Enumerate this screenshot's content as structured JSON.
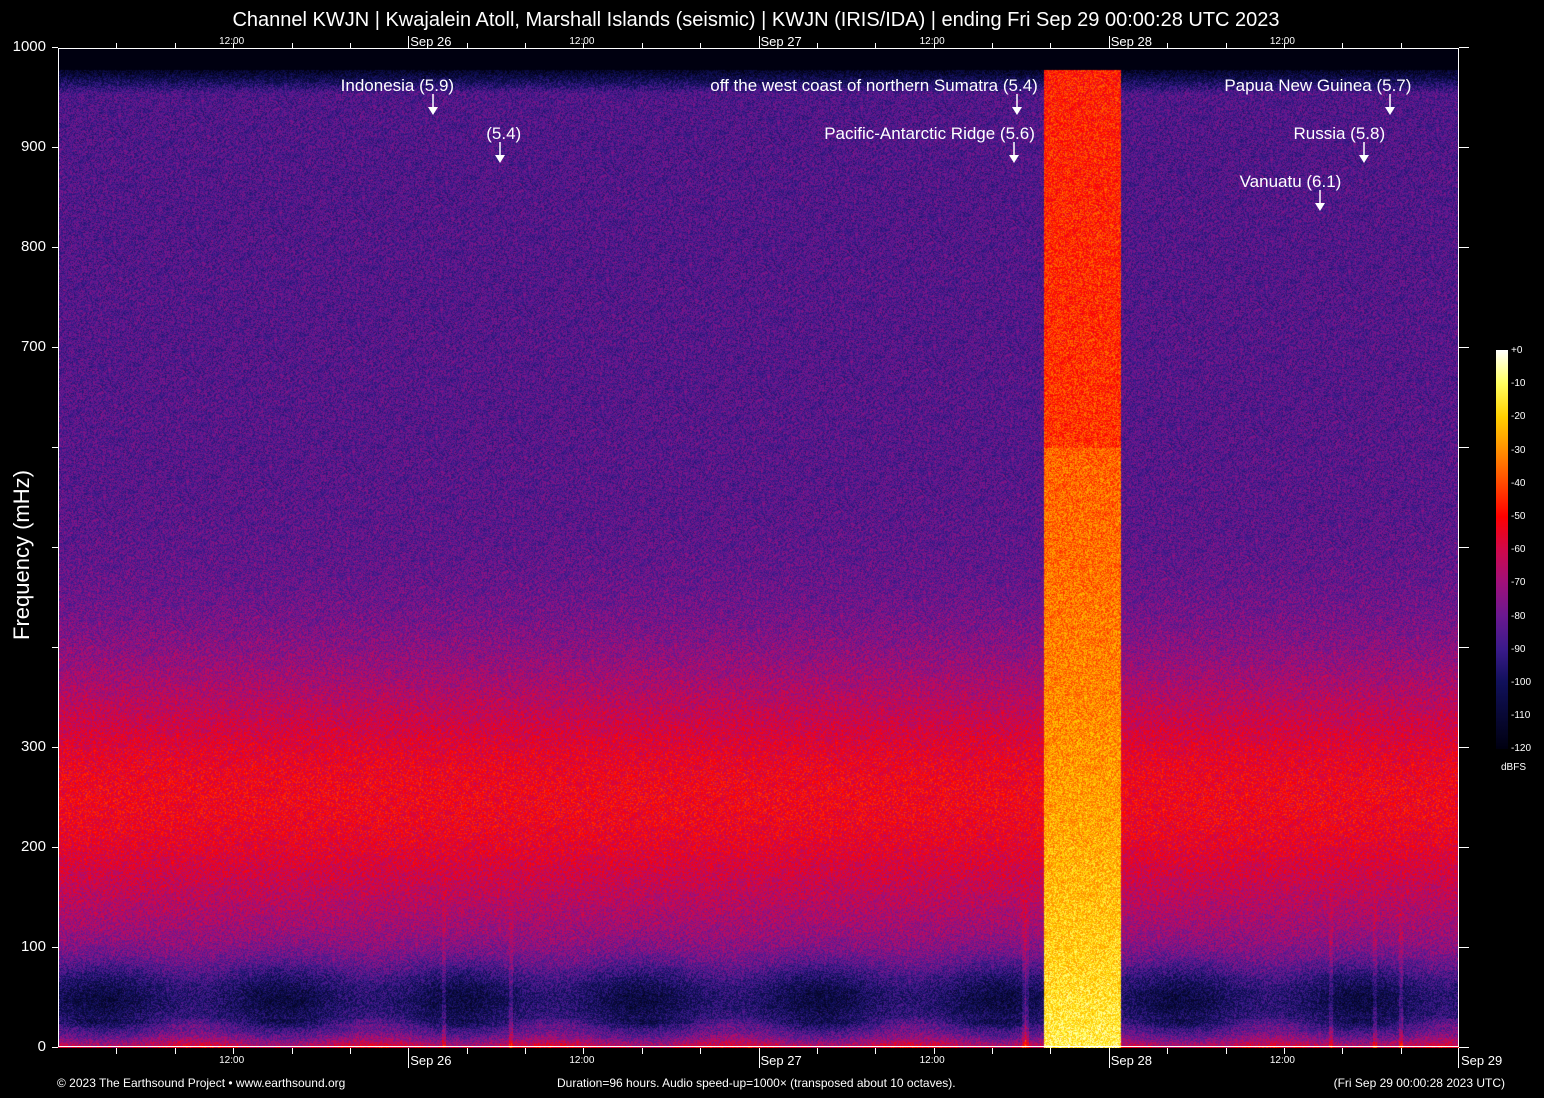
{
  "chart_data": {
    "type": "heatmap",
    "title": "Channel KWJN | Kwajalein Atoll, Marshall Islands (seismic) | KWJN (IRIS/IDA) | ending Fri Sep 29 00:00:28 UTC 2023",
    "ylabel": "Frequency (mHz)",
    "ylim": [
      0,
      1000
    ],
    "yticks": [
      {
        "value": 0,
        "label": "0"
      },
      {
        "value": 100,
        "label": "100"
      },
      {
        "value": 200,
        "label": "200"
      },
      {
        "value": 300,
        "label": "300"
      },
      {
        "value": 400,
        "label": ""
      },
      {
        "value": 500,
        "label": ""
      },
      {
        "value": 600,
        "label": ""
      },
      {
        "value": 700,
        "label": "700"
      },
      {
        "value": 800,
        "label": "800"
      },
      {
        "value": 900,
        "label": "900"
      },
      {
        "value": 1000,
        "label": "1000"
      }
    ],
    "xlim_hours": [
      0,
      96
    ],
    "xticks_major": [
      {
        "hour": 24,
        "label": "Sep 26"
      },
      {
        "hour": 48,
        "label": "Sep 27"
      },
      {
        "hour": 72,
        "label": "Sep 28"
      },
      {
        "hour": 96,
        "label": "Sep 29"
      }
    ],
    "xticks_minor_labeled": [
      {
        "hour": 12,
        "label": "12:00"
      },
      {
        "hour": 36,
        "label": "12:00"
      },
      {
        "hour": 60,
        "label": "12:00"
      },
      {
        "hour": 84,
        "label": "12:00"
      }
    ],
    "minor_tick_interval_hours": 4,
    "colorbar": {
      "unit": "dBFS",
      "range": [
        -120,
        0
      ],
      "ticks": [
        "+0",
        "-10",
        "-20",
        "-30",
        "-40",
        "-50",
        "-60",
        "-70",
        "-80",
        "-90",
        "-100",
        "-110",
        "-120"
      ],
      "colors": [
        "#000010",
        "#10105a",
        "#3a1a8a",
        "#6a1890",
        "#a0107a",
        "#d0084a",
        "#ff0000",
        "#ff4a00",
        "#ff9000",
        "#ffd000",
        "#ffff60",
        "#ffffff"
      ]
    },
    "events": [
      {
        "label": "Indonesia (5.9)",
        "hour": 25.7
      },
      {
        "label": "(5.4)",
        "hour": 30.3
      },
      {
        "label": "off the west coast of northern Sumatra (5.4)",
        "hour": 65.7
      },
      {
        "label": "Pacific-Antarctic Ridge (5.6)",
        "hour": 65.5
      },
      {
        "label": "Vanuatu (6.1)",
        "hour": 86.5
      },
      {
        "label": "Russia (5.8)",
        "hour": 89.5
      },
      {
        "label": "Papua New Guinea (5.7)",
        "hour": 91.3
      }
    ],
    "broadband_noise_hours": [
      67.5,
      72.8
    ]
  },
  "footer": {
    "copyright": "© 2023 The Earthsound Project • www.earthsound.org",
    "description": "Duration=96 hours. Audio speed-up=1000× (transposed about 10 octaves).",
    "end_time": "(Fri Sep 29 00:00:28 2023 UTC)"
  }
}
